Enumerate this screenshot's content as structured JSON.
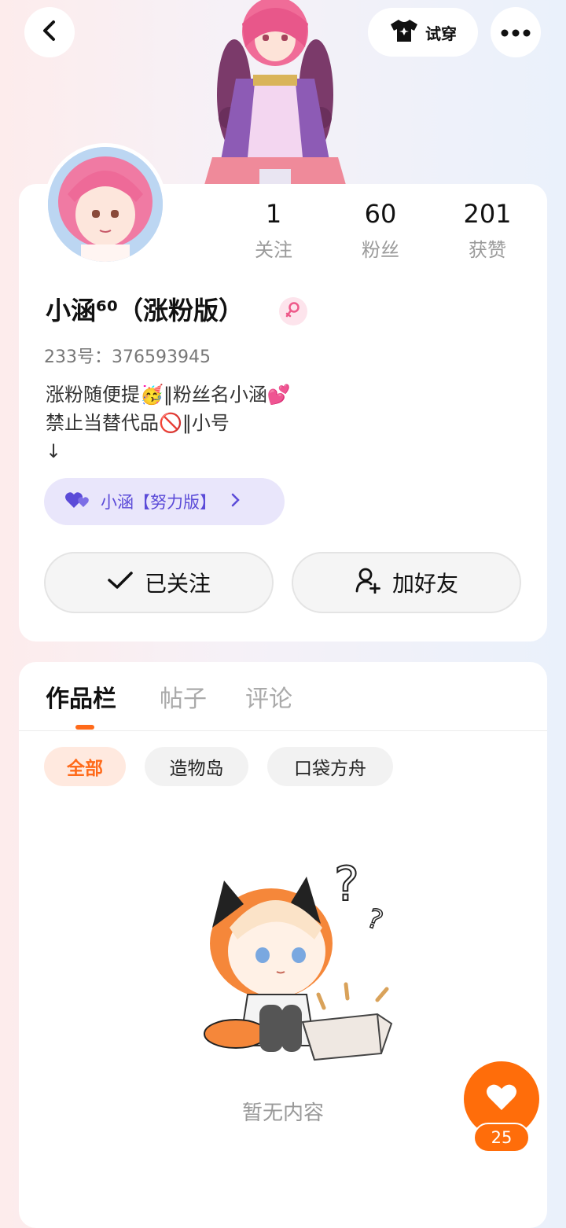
{
  "header": {
    "try_on_label": "试穿",
    "back_icon": "chevron-left-icon",
    "more_icon": "more-dots-icon"
  },
  "profile": {
    "stats": [
      {
        "value": "1",
        "label": "关注"
      },
      {
        "value": "60",
        "label": "粉丝"
      },
      {
        "value": "201",
        "label": "获赞"
      }
    ],
    "name": "小涵⁶⁰（涨粉版）",
    "gender_icon": "female-icon",
    "uid": "233号：376593945",
    "bio_lines": [
      "涨粉随便提🥳‖粉丝名小涵💕",
      "禁止当替代品🚫‖小号",
      "↓"
    ],
    "linked_account": "小涵【努力版】",
    "follow_button": "已关注",
    "add_friend_button": "加好友"
  },
  "works": {
    "tabs": [
      "作品栏",
      "帖子",
      "评论"
    ],
    "filters": [
      "全部",
      "造物岛",
      "口袋方舟"
    ],
    "empty_text": "暂无内容"
  },
  "fab": {
    "count": "25"
  },
  "colors": {
    "accent": "#ff6d0a",
    "purple": "#5b4bd8"
  }
}
